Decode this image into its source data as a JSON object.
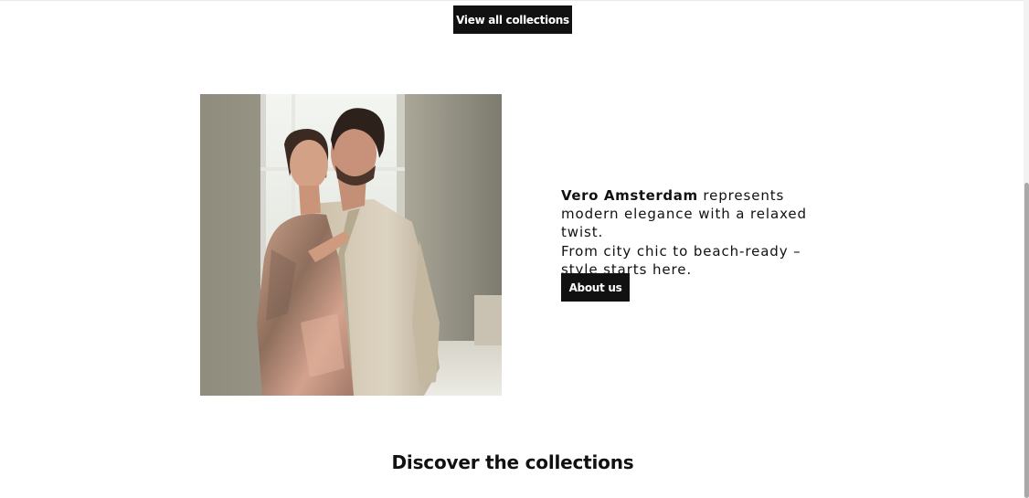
{
  "collections_button": {
    "label": "View all collections"
  },
  "about": {
    "brand": "Vero Amsterdam",
    "text_line1": " represents modern elegance with a relaxed twist.",
    "text_line2": "From city chic to beach-ready – style starts here.",
    "button_label": "About us"
  },
  "photo": {
    "alt": "Couple in linen and tie-dye outfits"
  },
  "discover": {
    "title": "Discover the collections"
  },
  "colors": {
    "button_bg": "#111111",
    "button_text": "#ffffff",
    "text": "#111111",
    "background": "#ffffff"
  }
}
